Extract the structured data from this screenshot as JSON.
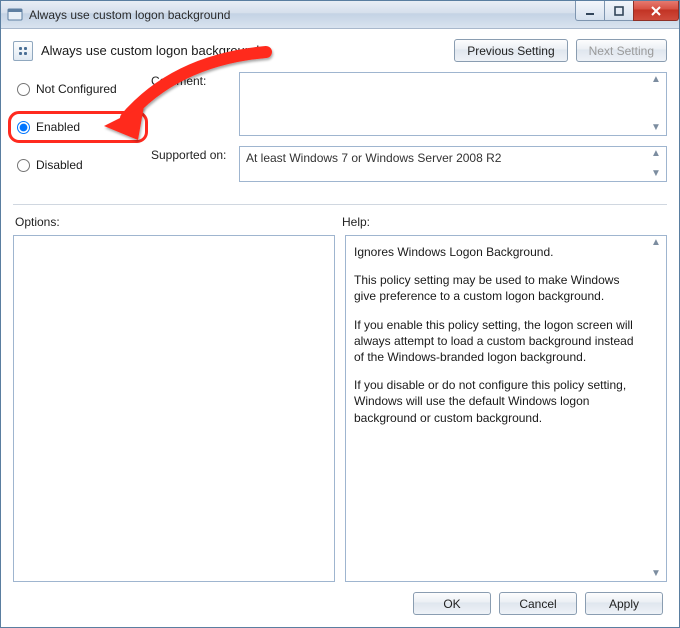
{
  "window": {
    "title": "Always use custom logon background"
  },
  "header": {
    "title": "Always use custom logon background"
  },
  "nav": {
    "previous": "Previous Setting",
    "next": "Next Setting"
  },
  "radios": {
    "not_configured": "Not Configured",
    "enabled": "Enabled",
    "disabled": "Disabled",
    "selected": "enabled"
  },
  "labels": {
    "comment": "Comment:",
    "supported_on": "Supported on:",
    "options": "Options:",
    "help": "Help:"
  },
  "supported_text": "At least Windows 7 or Windows Server 2008 R2",
  "help": {
    "p1": "Ignores Windows Logon Background.",
    "p2": "This policy setting may be used to make Windows give preference to a custom logon background.",
    "p3": "If you enable this policy setting, the logon screen will always attempt to load a custom background instead of the Windows-branded logon background.",
    "p4": "If you disable or do not configure this policy setting, Windows will use the default Windows logon background or custom background."
  },
  "footer": {
    "ok": "OK",
    "cancel": "Cancel",
    "apply": "Apply"
  }
}
